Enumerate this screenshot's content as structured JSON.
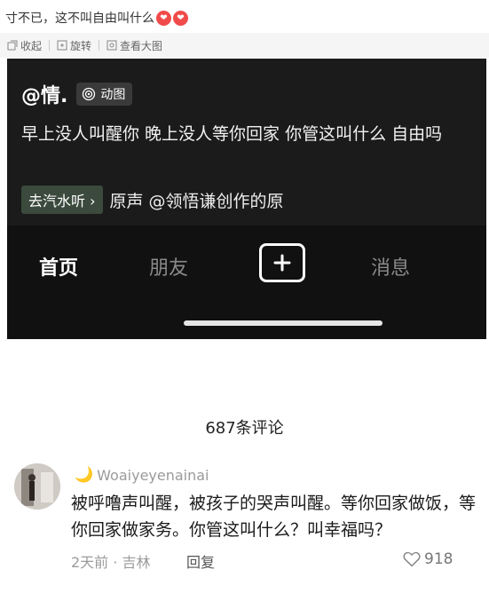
{
  "post": {
    "text": "寸不已，这不叫自由叫什么",
    "emojis": [
      "heart-eyes-emoji",
      "heart-eyes-emoji"
    ]
  },
  "toolbar": {
    "collapse_label": "收起",
    "rotate_label": "旋转",
    "view_large_label": "查看大图"
  },
  "screenshot": {
    "mention": "@情.",
    "gif_badge": "动图",
    "caption": "早上没人叫醒你 晚上没人等你回家 你管这叫什么 自由吗",
    "listen_button": "去汽水听",
    "music_text": "原声  @领悟谦创作的原",
    "nav": {
      "home": "首页",
      "friends": "朋友",
      "messages": "消息"
    }
  },
  "comments": {
    "count_label": "687条评论",
    "items": [
      {
        "username": "Woaiyeyenainai",
        "text": "被呼噜声叫醒，被孩子的哭声叫醒。等你回家做饭，等你回家做家务。你管这叫什么？叫幸福吗？",
        "time_location": "2天前 · 吉林",
        "reply_label": "回复",
        "likes": "918"
      }
    ]
  },
  "colors": {
    "screenshot_bg": "#161616",
    "emoji_red": "#f04b4b",
    "listen_btn_bg": "#3b4a3d"
  }
}
